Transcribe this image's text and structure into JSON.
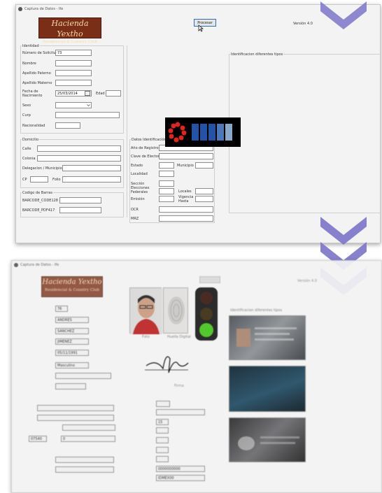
{
  "window1": {
    "title": "Captura de Datos - Ife",
    "logo_line1": "Hacienda Yextho",
    "logo_line2": "Residencial & Country Club",
    "process_button": "Procesar",
    "version": "Versión 4.0",
    "right_group_title": "Identificacion diferentes tipos",
    "identidad": {
      "group_title": "Identidad",
      "solicitud_label": "Número de Solicitud",
      "solicitud_value": "73",
      "nombre_label": "Nombre",
      "paterno_label": "Apellido Paterno",
      "materno_label": "Apellido Materno",
      "fecha_label": "Fecha de Nacimiento",
      "fecha_value": "25/03/2014",
      "edad_label": "Edad",
      "sexo_label": "Sexo",
      "curp_label": "Curp",
      "nacionalidad_label": "Nacionalidad"
    },
    "domicilio": {
      "group_title": "Domicilio",
      "calle_label": "Calle",
      "colonia_label": "Colonia",
      "delegacion_label": "Delegacion / Municipio",
      "cp_label": "CP",
      "folio_label": "Folio"
    },
    "barras": {
      "group_title": "Codigo de Barras",
      "code128_label": "BARCODE_CODE128",
      "pdf417_label": "BARCODE_PDF417"
    },
    "datos": {
      "group_title": "Datos Identificación",
      "anio_label": "Año de Registro",
      "clave_label": "Clave de Elector",
      "estado_label": "Estado",
      "municipio_label": "Municipio",
      "localidad_label": "Localidad",
      "seccion_label": "Sección",
      "elecciones_label": "Elecciones Federales",
      "locales_label": "Locales",
      "emision_label": "Emisión",
      "vigencia_label": "Vigencia Hasta",
      "ocr_label": "OCR",
      "mrz_label": "MRZ"
    }
  },
  "window2": {
    "title": "Captura de Datos - Ife",
    "logo_line1": "Hacienda Yextho",
    "logo_line2": "Residencial & Country Club",
    "version": "Versión 4.0",
    "right_group_title": "Identificacion diferentes tipos",
    "photo_caption": "Foto",
    "fingerprint_caption": "Huella Digital",
    "signature_caption": "Firma",
    "solicitud_value": "76",
    "nombre_value": "ANDRES",
    "paterno_value": "SANCHEZ",
    "materno_value": "JIMENEZ",
    "fecha_value": "05/11/1991",
    "sexo_value": "Masculino",
    "cp_value": "07540",
    "folio_value": "0",
    "estado_value": "15",
    "ocr_value": "0000000000",
    "mrz_value": "IDMEX00"
  },
  "colors": {
    "logo_bg": "#7a2e17",
    "chevron": "#7b74c9",
    "loader_red": "#e0241e",
    "loader_blue": "#2452a6",
    "traffic_green": "#43c41a"
  },
  "icons": [
    "app-icon",
    "chevron-down-icon",
    "cursor-icon",
    "calendar-icon",
    "loading-spinner-icon",
    "traffic-light-icon"
  ]
}
